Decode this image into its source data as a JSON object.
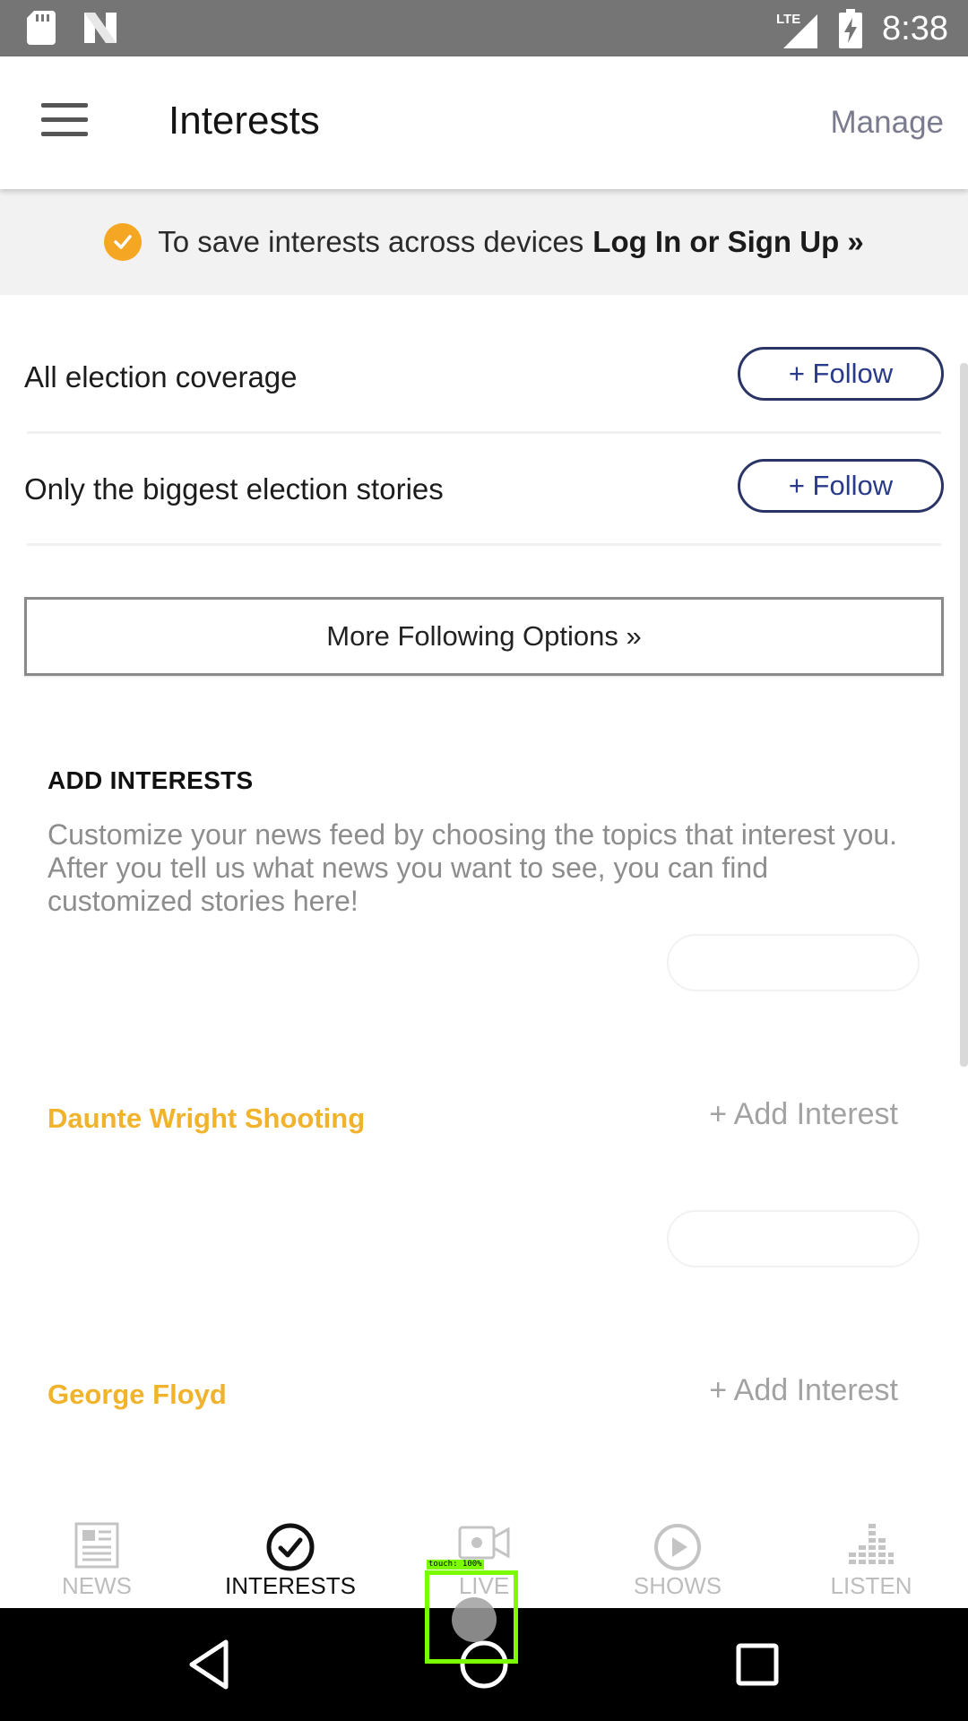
{
  "status_bar": {
    "time": "8:38",
    "network": "LTE"
  },
  "app_bar": {
    "title": "Interests",
    "manage_label": "Manage"
  },
  "banner": {
    "text": "To save interests across devices",
    "link": "Log In or Sign Up »"
  },
  "follow_options": [
    {
      "label": "All election coverage",
      "button": "+ Follow"
    },
    {
      "label": "Only the biggest election stories",
      "button": "+ Follow"
    }
  ],
  "more_button": "More Following Options »",
  "add_interests": {
    "heading": "ADD INTERESTS",
    "description": "Customize your news feed by choosing the topics that interest you. After you tell us what news you want to see, you can find customized stories here!"
  },
  "interests": [
    {
      "name": "Daunte Wright Shooting",
      "action": "+ Add Interest"
    },
    {
      "name": "George Floyd",
      "action": "+ Add Interest"
    }
  ],
  "tabs": [
    {
      "label": "NEWS",
      "icon": "newspaper-icon",
      "active": false
    },
    {
      "label": "INTERESTS",
      "icon": "check-circle-icon",
      "active": true
    },
    {
      "label": "LIVE",
      "icon": "video-camera-icon",
      "active": false
    },
    {
      "label": "SHOWS",
      "icon": "play-circle-icon",
      "active": false
    },
    {
      "label": "LISTEN",
      "icon": "equalizer-icon",
      "active": false
    }
  ],
  "touch_indicator": {
    "label": "touch: 100%"
  },
  "colors": {
    "accent": "#f5a623",
    "interest_name": "#f1b32c",
    "follow_border": "#2a3566",
    "status_bar": "#757575"
  }
}
